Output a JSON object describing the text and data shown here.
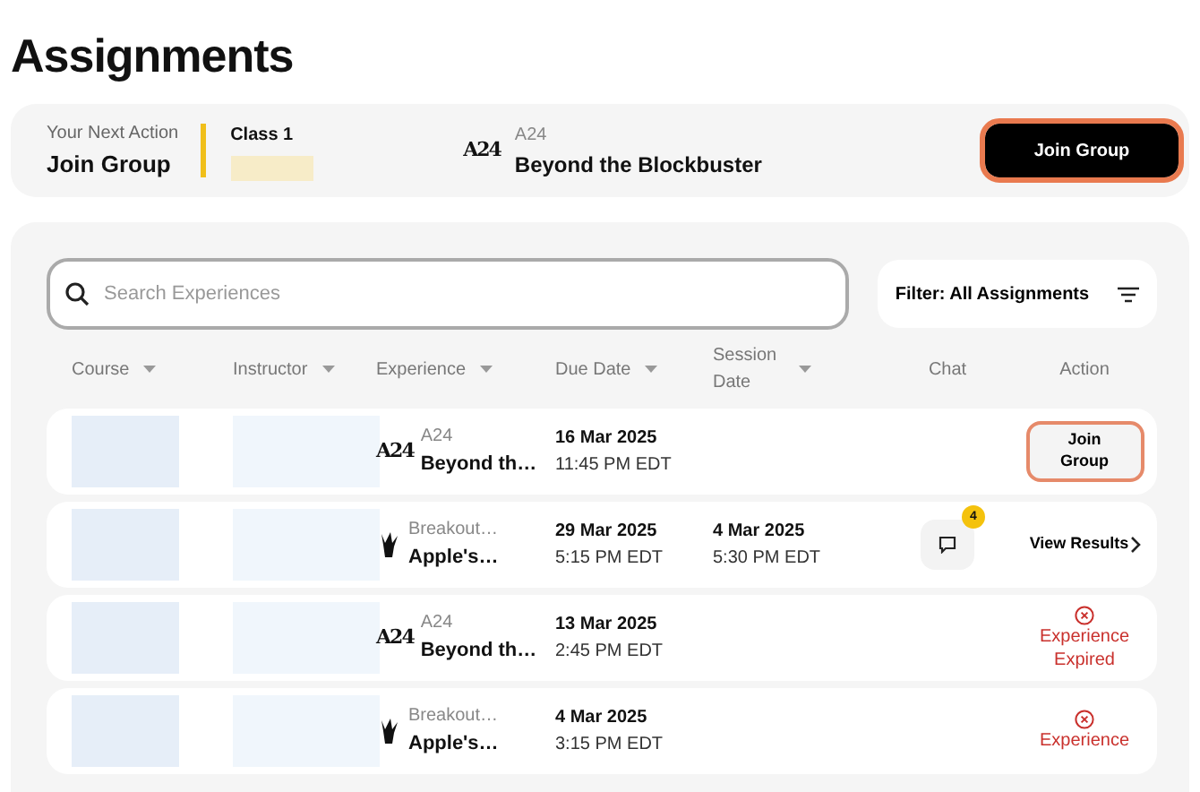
{
  "page_title": "Assignments",
  "next_action": {
    "label": "Your Next Action",
    "action": "Join Group",
    "class_name": "Class 1",
    "logo": "A24",
    "provider": "A24",
    "experience": "Beyond the Blockbuster",
    "button": "Join Group"
  },
  "search": {
    "placeholder": "Search Experiences"
  },
  "filter": {
    "label": "Filter: All Assignments"
  },
  "columns": [
    {
      "label": "Course",
      "sortable": true
    },
    {
      "label": "Instructor",
      "sortable": true
    },
    {
      "label": "Experience",
      "sortable": true
    },
    {
      "label": "Due Date",
      "sortable": true
    },
    {
      "label": "Session Date",
      "sortable": true
    },
    {
      "label": "Chat",
      "sortable": false
    },
    {
      "label": "Action",
      "sortable": false
    }
  ],
  "rows": [
    {
      "kind": "a24",
      "logo": "A24",
      "provider": "A24",
      "experience": "Beyond th…",
      "due_date": "16 Mar 2025",
      "due_time": "11:45 PM EDT",
      "action": {
        "kind": "join",
        "label": "Join Group"
      }
    },
    {
      "kind": "figure",
      "provider": "Breakout…",
      "experience": "Apple's…",
      "due_date": "29 Mar 2025",
      "due_time": "5:15 PM EDT",
      "session_date": "4 Mar 2025",
      "session_time": "5:30 PM EDT",
      "chat": {
        "badge": "4"
      },
      "action": {
        "kind": "view",
        "label": "View Results"
      }
    },
    {
      "kind": "a24",
      "logo": "A24",
      "provider": "A24",
      "experience": "Beyond th…",
      "due_date": "13 Mar 2025",
      "due_time": "2:45 PM EDT",
      "action": {
        "kind": "expired",
        "label": "Experience Expired"
      }
    },
    {
      "kind": "figure",
      "provider": "Breakout…",
      "experience": "Apple's…",
      "due_date": "4 Mar 2025",
      "due_time": "3:15 PM EDT",
      "action": {
        "kind": "expired",
        "label": "Experience"
      }
    }
  ]
}
